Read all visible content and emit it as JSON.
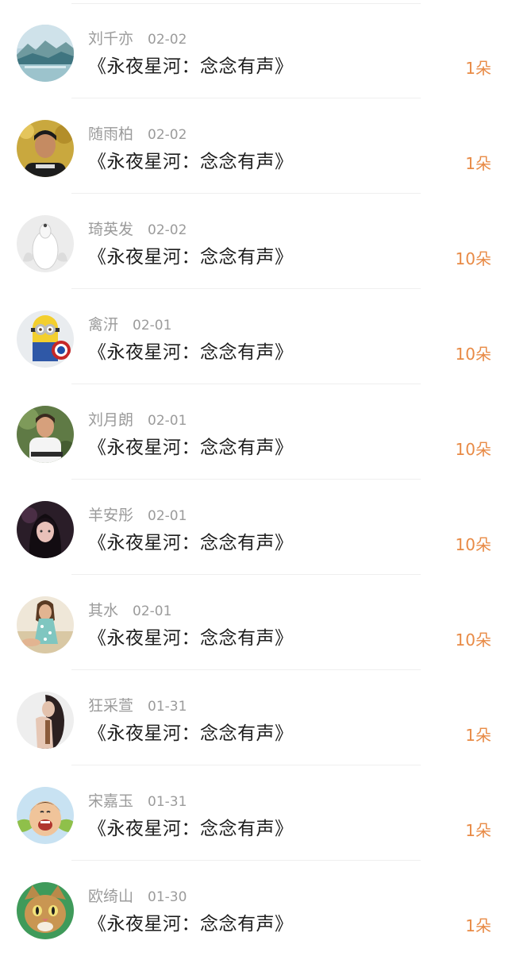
{
  "gift_records": [
    {
      "user": "刘千亦",
      "date": "02-02",
      "title": "《永夜星河：念念有声》",
      "amount": "1朵",
      "avatar": "landscape-avatar"
    },
    {
      "user": "随雨柏",
      "date": "02-02",
      "title": "《永夜星河：念念有声》",
      "amount": "1朵",
      "avatar": "man-avatar"
    },
    {
      "user": "琦英发",
      "date": "02-02",
      "title": "《永夜星河：念念有声》",
      "amount": "10朵",
      "avatar": "dog-avatar"
    },
    {
      "user": "禽汧",
      "date": "02-01",
      "title": "《永夜星河：念念有声》",
      "amount": "10朵",
      "avatar": "minion-avatar"
    },
    {
      "user": "刘月朗",
      "date": "02-01",
      "title": "《永夜星河：念念有声》",
      "amount": "10朵",
      "avatar": "man-avatar"
    },
    {
      "user": "羊安彤",
      "date": "02-01",
      "title": "《永夜星河：念念有声》",
      "amount": "10朵",
      "avatar": "girl-avatar"
    },
    {
      "user": "其水",
      "date": "02-01",
      "title": "《永夜星河：念念有声》",
      "amount": "10朵",
      "avatar": "woman-avatar"
    },
    {
      "user": "狂采萱",
      "date": "01-31",
      "title": "《永夜星河：念念有声》",
      "amount": "1朵",
      "avatar": "woman-avatar"
    },
    {
      "user": "宋嘉玉",
      "date": "01-31",
      "title": "《永夜星河：念念有声》",
      "amount": "1朵",
      "avatar": "child-avatar"
    },
    {
      "user": "欧绮山",
      "date": "01-30",
      "title": "《永夜星河：念念有声》",
      "amount": "1朵",
      "avatar": "cat-avatar"
    }
  ],
  "colors": {
    "amount": "#e88a45",
    "meta": "#9b9b9b",
    "title": "#1e1e1e",
    "divider": "#efefef"
  }
}
